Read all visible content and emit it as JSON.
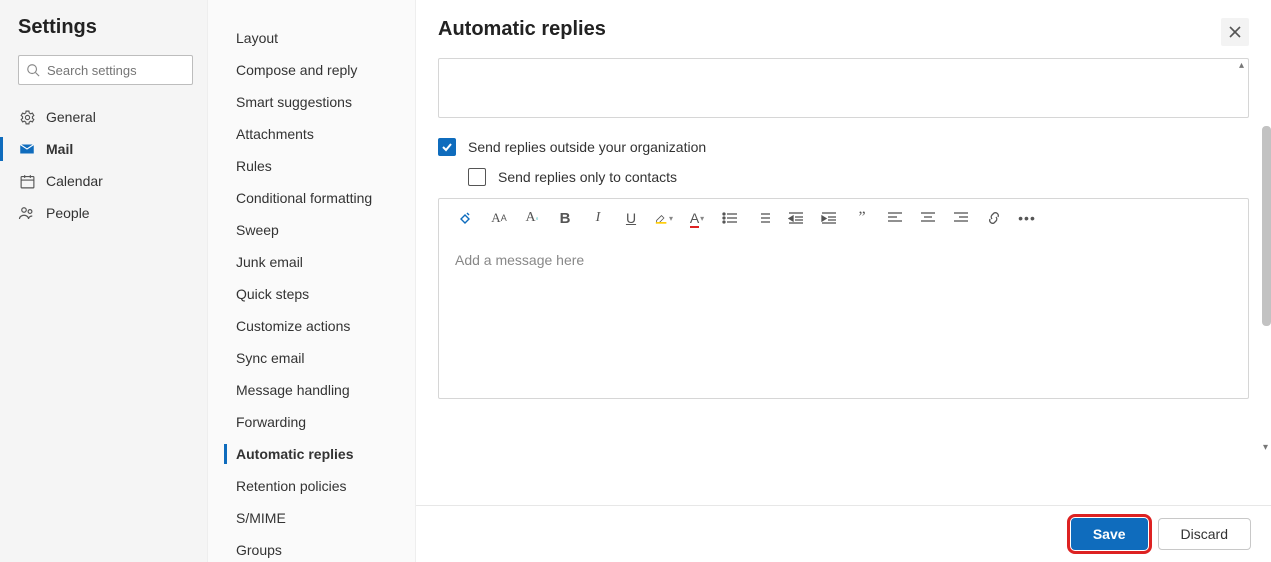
{
  "header": {
    "title": "Settings"
  },
  "search": {
    "placeholder": "Search settings"
  },
  "nav": {
    "general": "General",
    "mail": "Mail",
    "calendar": "Calendar",
    "people": "People",
    "active": "mail"
  },
  "subnav": {
    "items": [
      "Layout",
      "Compose and reply",
      "Smart suggestions",
      "Attachments",
      "Rules",
      "Conditional formatting",
      "Sweep",
      "Junk email",
      "Quick steps",
      "Customize actions",
      "Sync email",
      "Message handling",
      "Forwarding",
      "Automatic replies",
      "Retention policies",
      "S/MIME",
      "Groups"
    ],
    "active": "Automatic replies"
  },
  "main": {
    "title": "Automatic replies",
    "cb_outside": {
      "label": "Send replies outside your organization",
      "checked": true
    },
    "cb_contacts": {
      "label": "Send replies only to contacts",
      "checked": false
    },
    "editor": {
      "placeholder": "Add a message here"
    },
    "buttons": {
      "save": "Save",
      "discard": "Discard"
    }
  },
  "colors": {
    "accent": "#0f6cbd",
    "highlight": "#d22"
  }
}
